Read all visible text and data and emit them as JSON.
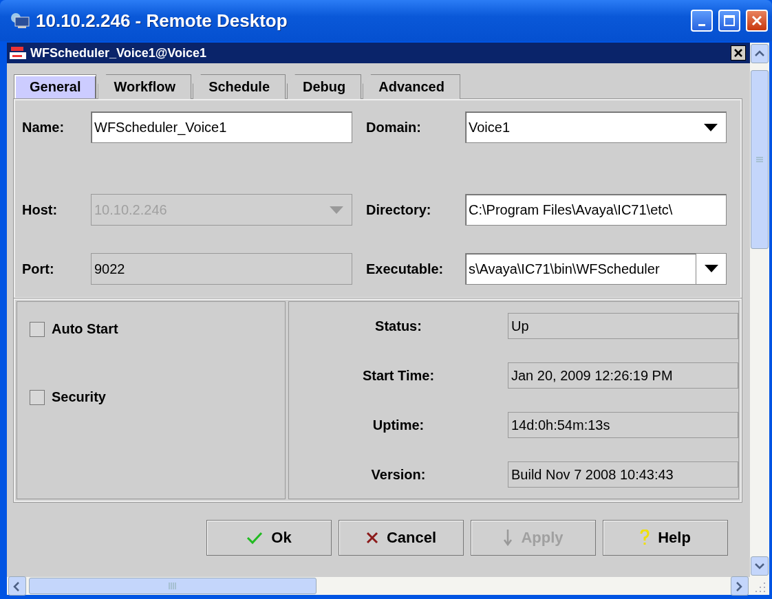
{
  "window": {
    "title": "10.10.2.246 - Remote Desktop"
  },
  "frame": {
    "title": "WFScheduler_Voice1@Voice1"
  },
  "tabs": [
    {
      "label": "General",
      "selected": true
    },
    {
      "label": "Workflow",
      "selected": false
    },
    {
      "label": "Schedule",
      "selected": false
    },
    {
      "label": "Debug",
      "selected": false
    },
    {
      "label": "Advanced",
      "selected": false
    }
  ],
  "field_rows": [
    [
      {
        "label": "Name:",
        "value": "WFScheduler_Voice1",
        "kind": "text",
        "disabled": false
      },
      {
        "label": "Domain:",
        "value": "Voice1",
        "kind": "combo",
        "disabled": false
      }
    ],
    [
      {
        "label": "Host:",
        "value": "10.10.2.246",
        "kind": "combo",
        "disabled": true
      },
      {
        "label": "Directory:",
        "value": "C:\\Program Files\\Avaya\\IC71\\etc\\",
        "kind": "text",
        "disabled": false
      }
    ],
    [
      {
        "label": "Port:",
        "value": "9022",
        "kind": "readonly",
        "disabled": false
      },
      {
        "label": "Executable:",
        "value": "s\\Avaya\\IC71\\bin\\WFScheduler",
        "kind": "editcombo",
        "disabled": false
      }
    ]
  ],
  "options": [
    {
      "label": "Auto Start",
      "checked": false
    },
    {
      "label": "Security",
      "checked": false
    }
  ],
  "status": [
    {
      "label": "Status:",
      "value": "Up"
    },
    {
      "label": "Start Time:",
      "value": "Jan 20, 2009 12:26:19 PM"
    },
    {
      "label": "Uptime:",
      "value": "14d:0h:54m:13s"
    },
    {
      "label": "Version:",
      "value": "Build Nov  7 2008 10:43:43"
    }
  ],
  "buttons": [
    {
      "label": "Ok",
      "kind": "ok",
      "disabled": false
    },
    {
      "label": "Cancel",
      "kind": "cancel",
      "disabled": false
    },
    {
      "label": "Apply",
      "kind": "apply",
      "disabled": true
    },
    {
      "label": "Help",
      "kind": "help",
      "disabled": false
    }
  ]
}
